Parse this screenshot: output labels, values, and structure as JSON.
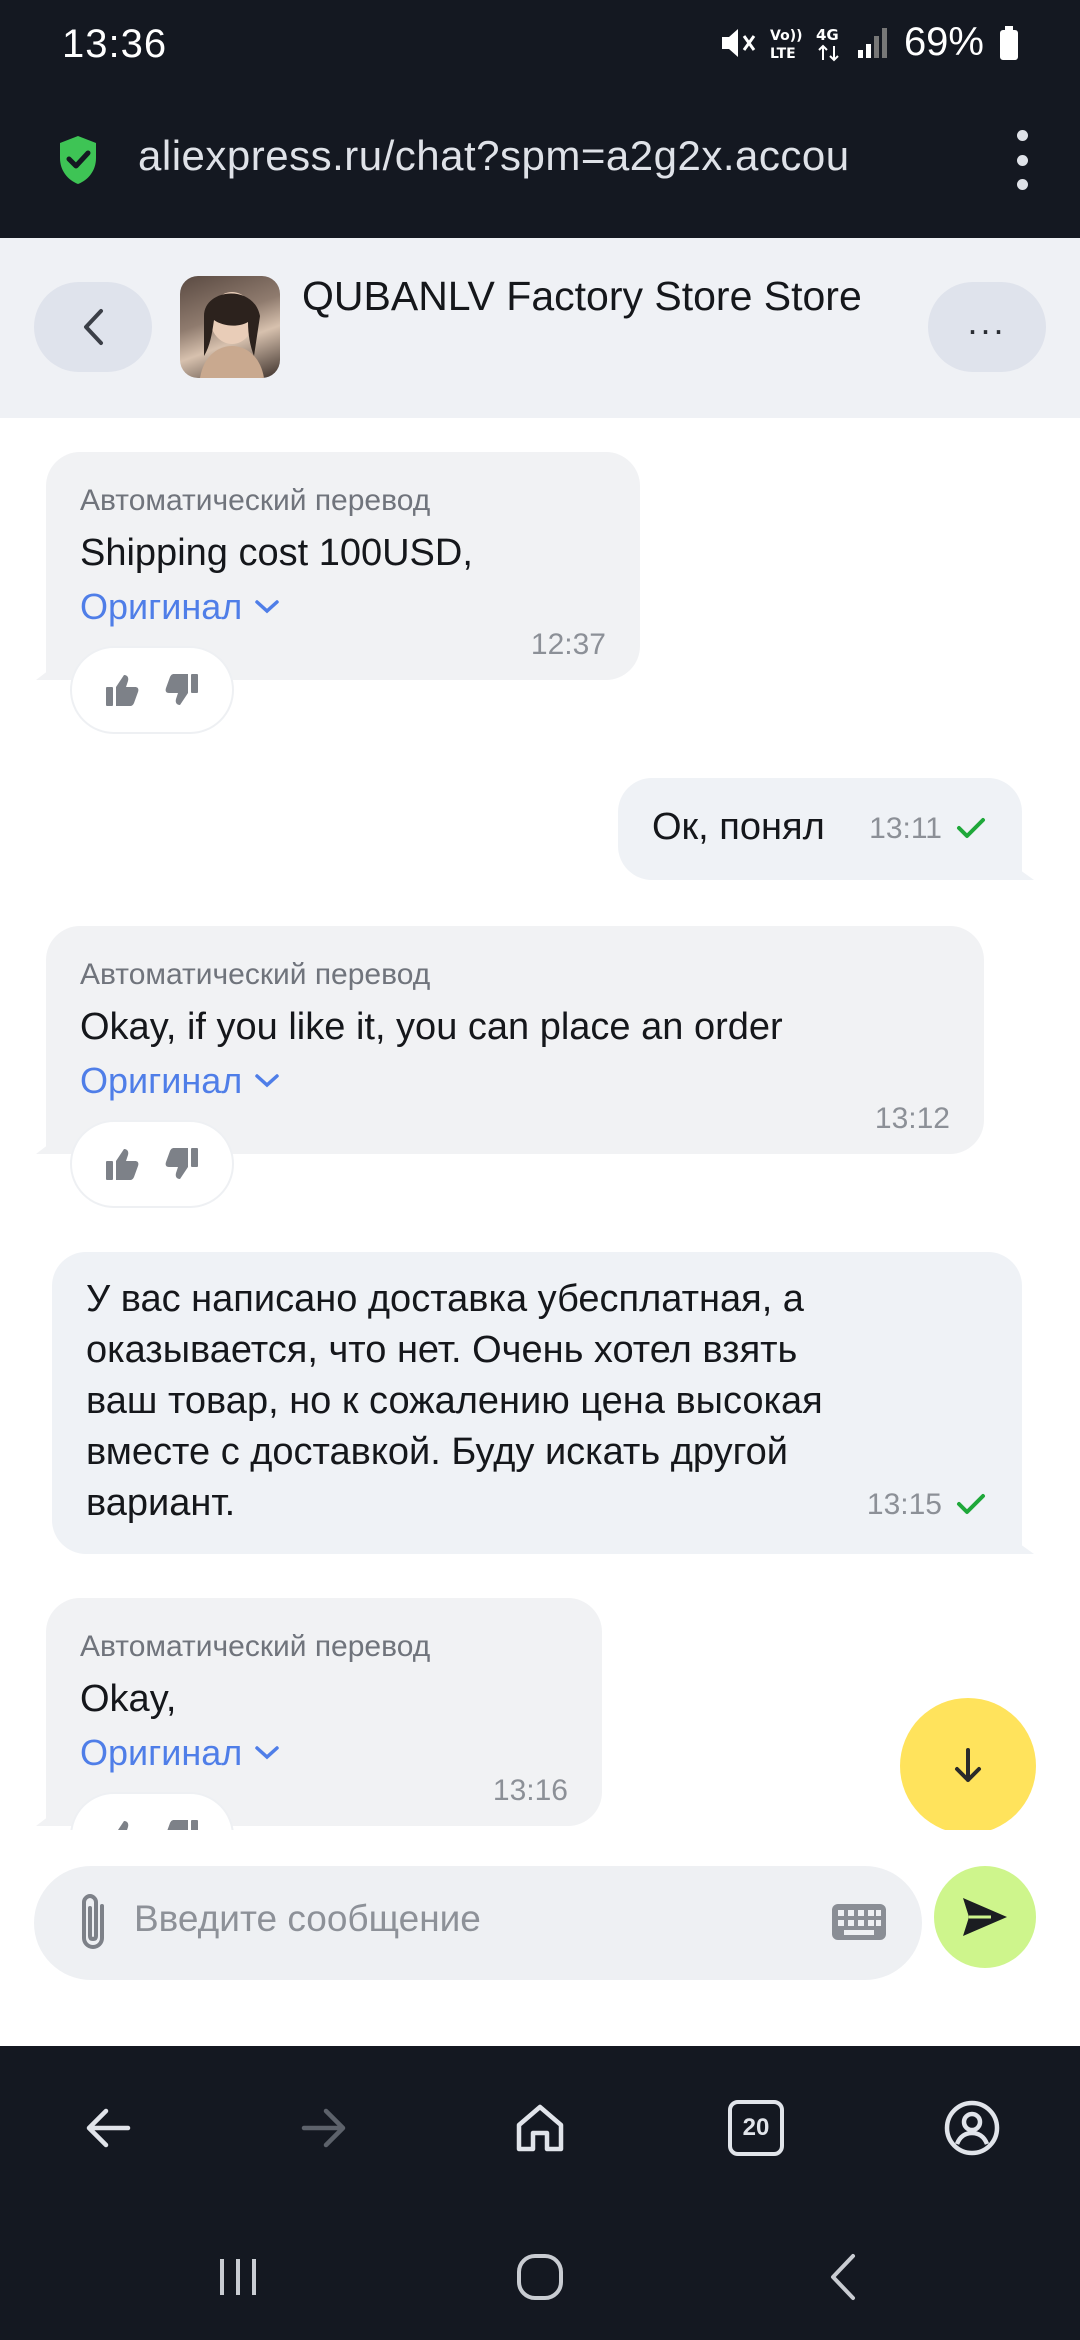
{
  "status_bar": {
    "time": "13:36",
    "battery": "69%"
  },
  "browser": {
    "url": "aliexpress.ru/chat?spm=a2g2x.accou",
    "tabs_count": "20"
  },
  "chat": {
    "store_name": "QUBANLV Factory Store Store",
    "more_label": "...",
    "messages": [
      {
        "direction": "incoming",
        "auto_label": "Автоматический перевод",
        "text": "Shipping cost 100USD,",
        "original_link": "Оригинал",
        "time": "12:37"
      },
      {
        "direction": "outgoing",
        "text": "Ок, понял",
        "time": "13:11"
      },
      {
        "direction": "incoming",
        "auto_label": "Автоматический перевод",
        "text": "Okay, if you like it, you can place an order",
        "original_link": "Оригинал",
        "time": "13:12"
      },
      {
        "direction": "outgoing",
        "text": "У вас написано доставка убесплатная, а оказывается, что нет. Очень хотел взять ваш товар, но к сожалению цена высокая вместе с доставкой. Буду искать другой вариант.",
        "time": "13:15"
      },
      {
        "direction": "incoming",
        "auto_label": "Автоматический перевод",
        "text": "Okay,",
        "original_link": "Оригинал",
        "time": "13:16"
      }
    ],
    "input_placeholder": "Введите сообщение"
  },
  "colors": {
    "accent_link": "#4f7ee8",
    "read_check": "#1fa83a",
    "fab_yellow": "#ffe35c",
    "send_green": "#cef58c",
    "dark_bar": "#141821"
  }
}
